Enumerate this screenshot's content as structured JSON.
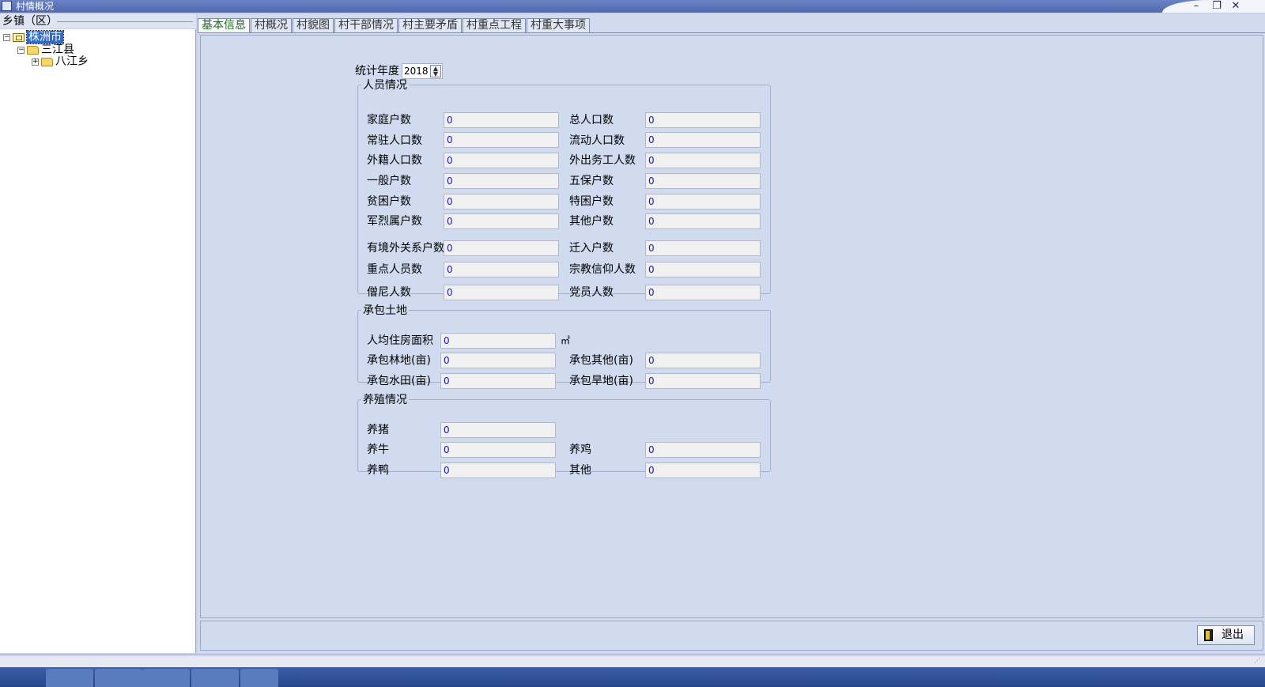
{
  "window": {
    "title": "村情概况"
  },
  "tree": {
    "header": "乡镇（区）",
    "nodes": [
      {
        "label": "株洲市",
        "expander": "−"
      },
      {
        "label": "三江县",
        "expander": "−"
      },
      {
        "label": "八江乡",
        "expander": "+"
      }
    ]
  },
  "tabs": [
    "基本信息",
    "村概况",
    "村貌图",
    "村干部情况",
    "村主要矛盾",
    "村重点工程",
    "村重大事项"
  ],
  "year": {
    "label": "统计年度",
    "value": "2018"
  },
  "personnel": {
    "title": "人员情况",
    "fields": [
      {
        "label": "家庭户数",
        "value": "0"
      },
      {
        "label": "总人口数",
        "value": "0"
      },
      {
        "label": "常驻人口数",
        "value": "0"
      },
      {
        "label": "流动人口数",
        "value": "0"
      },
      {
        "label": "外籍人口数",
        "value": "0"
      },
      {
        "label": "外出务工人数",
        "value": "0"
      },
      {
        "label": "一般户数",
        "value": "0"
      },
      {
        "label": "五保户数",
        "value": "0"
      },
      {
        "label": "贫困户数",
        "value": "0"
      },
      {
        "label": "特困户数",
        "value": "0"
      },
      {
        "label": "军烈属户数",
        "value": "0"
      },
      {
        "label": "其他户数",
        "value": "0"
      },
      {
        "label": "有境外关系户数",
        "value": "0"
      },
      {
        "label": "迁入户数",
        "value": "0"
      },
      {
        "label": "重点人员数",
        "value": "0"
      },
      {
        "label": "宗教信仰人数",
        "value": "0"
      },
      {
        "label": "僧尼人数",
        "value": "0"
      },
      {
        "label": "党员人数",
        "value": "0"
      }
    ]
  },
  "land": {
    "title": "承包土地",
    "fields": [
      {
        "label": "人均住房面积",
        "value": "0",
        "unit": "㎡"
      },
      {
        "label": "承包林地(亩)",
        "value": "0"
      },
      {
        "label": "承包其他(亩)",
        "value": "0"
      },
      {
        "label": "承包水田(亩)",
        "value": "0"
      },
      {
        "label": "承包旱地(亩)",
        "value": "0"
      }
    ]
  },
  "breeding": {
    "title": "养殖情况",
    "fields": [
      {
        "label": "养猪",
        "value": "0"
      },
      {
        "label": "养牛",
        "value": "0"
      },
      {
        "label": "养鸡",
        "value": "0"
      },
      {
        "label": "养鸭",
        "value": "0"
      },
      {
        "label": "其他",
        "value": "0"
      }
    ]
  },
  "buttons": {
    "exit": "退出"
  },
  "window_buttons": {
    "minimize": "–",
    "restore": "❐",
    "close": "✕"
  }
}
